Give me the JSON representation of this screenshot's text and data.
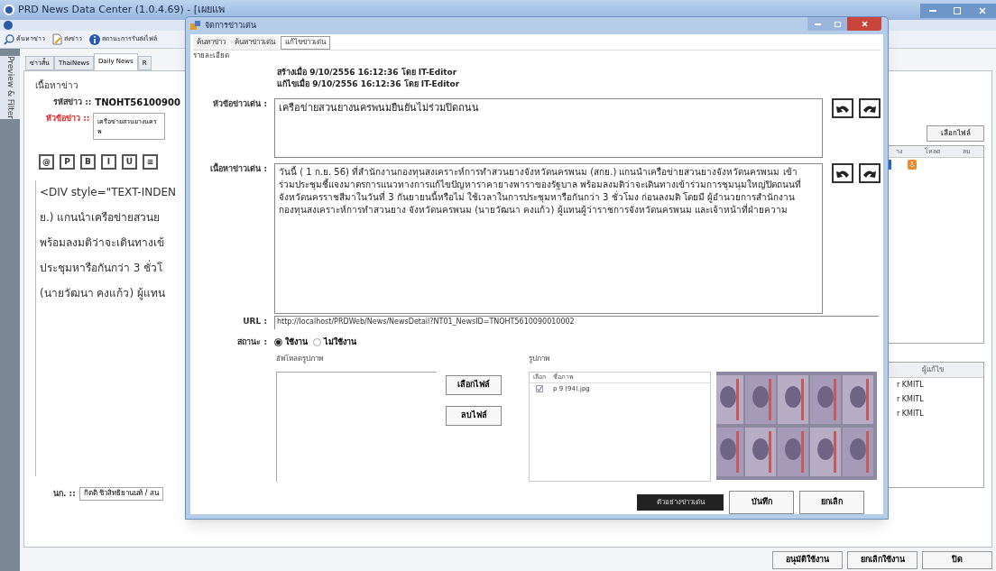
{
  "main_window": {
    "title": "PRD News Data Center (1.0.4.69) - [เผยแพ",
    "toolbar": [
      {
        "label": "ค้นหาข่าว",
        "kind": "search"
      },
      {
        "label": "ส่งข่าว",
        "kind": "document"
      },
      {
        "label": "สถานะการรับส่งไฟล์",
        "kind": "info"
      }
    ],
    "side_tab": "Preview & Filter",
    "tabs": [
      {
        "label": "ข่าวสั้น",
        "selected": false
      },
      {
        "label": "ThaiNews",
        "selected": false
      },
      {
        "label": "Daily News",
        "selected": true
      },
      {
        "label": "R",
        "selected": false
      }
    ],
    "group_title": "เนื้อหาข่าว",
    "news_id_label": "รหัสข่าว ::",
    "news_id": "TNOHT56100900",
    "headline_label": "หัวข้อข่าว ::",
    "headline": "เครือข่ายสวนยางนครพ",
    "format_buttons": [
      "@",
      "P",
      "B",
      "I",
      "U",
      "≡"
    ],
    "editor_lines": [
      "<DIV style=\"TEXT-INDEN",
      "ย.) แกนนำเครือข่ายสวนย",
      "พร้อมลงมติว่าจะเดินทางเข้",
      "ประชุมหารือกันกว่า 3 ชั่วโ",
      "(นายวัฒนา คงแก้ว) ผู้แทน"
    ],
    "reporter_label": "นก. ::",
    "reporter": "กิตติ ชิวสิทธิยานนท์ / สน",
    "choose_file_button": "เลือกไฟล์",
    "file_columns": [
      "าง",
      "โหลด",
      "ลบ"
    ],
    "editor_column": "ผู้แก้ไข",
    "editor_rows": [
      "r KMITL",
      "r KMITL",
      "r KMITL"
    ],
    "buttons": [
      "อนุมัติใช้งาน",
      "ยกเลิกใช้งาน",
      "ปิด"
    ]
  },
  "dialog": {
    "title": "จัดการข่าวเด่น",
    "tabs": [
      {
        "label": "ค้นหาข่าว",
        "selected": false
      },
      {
        "label": "ค้นหาข่าวเด่น",
        "selected": false
      },
      {
        "label": "แก้ไขข่าวเด่น",
        "selected": true
      }
    ],
    "section": "รายละเอียด",
    "created": "สร้างเมื่อ 9/10/2556 16:12:36 โดย IT-Editor",
    "modified": "แก้ไขเมื่อ 9/10/2556 16:12:36 โดย IT-Editor",
    "headline_label": "หัวข้อข่าวเด่น :",
    "headline": "เครือข่ายสวนยางนครพนมยืนยันไม่ร่วมปิดถนน",
    "body_label": "เนื้อหาข่าวเด่น :",
    "body": "วันนี้ ( 1 ก.ย. 56)  ที่สำนักงานกองทุนสงเคราะห์การทำสวนยางจังหวัดนครพนม (สกย.) แกนนำเครือข่ายสวนยางจังหวัดนครพนม เข้าร่วมประชุมชี้แจงมาตรการแนวทางการแก้ไขปัญหาราคายางพาราของรัฐบาล พร้อมลงมติว่าจะเดินทางเข้าร่วมการชุมนุมใหญ่ปิดถนนที่จังหวัดนครราชสีมาในวันที่ 3 กันยายนนี้หรือไม่ ใช้เวลาในการประชุมหารือกันกว่า 3 ชั่วโมง ก่อนลงมติ โดยมี ผู้อำนวยการสำนักงานกองทุนสงเคราะห์การทำสวนยาง จังหวัดนครพนม (นายวัฒนา คงแก้ว) ผู้แทนผู้ว่าราชการจังหวัดนครพนม และเจ้าหน้าที่ฝ่ายความ",
    "url_label": "URL :",
    "url": "http://localhost/PRDWeb/News/NewsDetail?NT01_NewsID=TNOHT5610090010002",
    "status_label": "สถานะ :",
    "status_options": [
      {
        "label": "ใช้งาน",
        "selected": true
      },
      {
        "label": "ไม่ใช้งาน",
        "selected": false
      }
    ],
    "upload_label": "อัพโหลดรูปภาพ",
    "choose_file_button": "เลือกไฟล์",
    "delete_file_button": "ลบไฟล์",
    "images_label": "รูปภาพ",
    "image_columns": [
      "เลือก",
      "ชื่อภาพ"
    ],
    "images": [
      {
        "name": "p 9 (94).jpg",
        "checked": true
      }
    ],
    "preview_button": "ตัวอย่างข่าวเด่น",
    "save_button": "บันทึก",
    "cancel_button": "ยกเลิก"
  }
}
